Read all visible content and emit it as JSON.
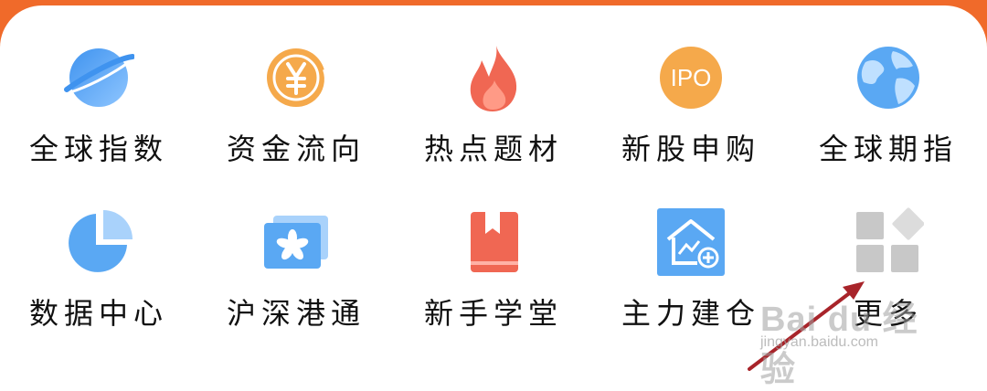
{
  "grid": {
    "row1": [
      {
        "label": "全球指数",
        "icon": "planet-icon"
      },
      {
        "label": "资金流向",
        "icon": "yuan-coin-icon"
      },
      {
        "label": "热点题材",
        "icon": "flame-icon"
      },
      {
        "label": "新股申购",
        "icon": "ipo-icon",
        "icon_text": "IPO"
      },
      {
        "label": "全球期指",
        "icon": "globe-icon"
      }
    ],
    "row2": [
      {
        "label": "数据中心",
        "icon": "pie-chart-icon"
      },
      {
        "label": "沪深港通",
        "icon": "hk-flag-icon"
      },
      {
        "label": "新手学堂",
        "icon": "book-icon"
      },
      {
        "label": "主力建仓",
        "icon": "house-chart-icon"
      },
      {
        "label": "更多",
        "icon": "more-grid-icon"
      }
    ]
  },
  "watermark": {
    "main": "Bai du 经验",
    "sub": "jingyan.baidu.com"
  },
  "colors": {
    "banner": "#f06a2a",
    "blue": "#5aa8f3",
    "orange": "#f5a94b",
    "red": "#f06753",
    "gray": "#c8c8c8"
  }
}
